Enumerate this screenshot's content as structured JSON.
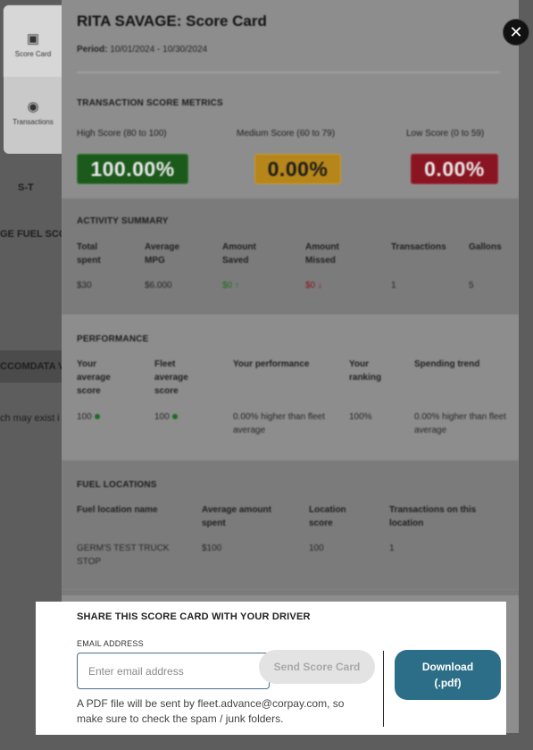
{
  "background": {
    "fragments": [
      "S-T",
      "GE FUEL SCO",
      "CCOMDATA V",
      "ch may exist i"
    ]
  },
  "side_tabs": [
    {
      "label": "Score Card",
      "icon": "scorecard-icon"
    },
    {
      "label": "Transactions",
      "icon": "transactions-icon"
    }
  ],
  "header": {
    "title": "RITA SAVAGE: Score Card",
    "period_label": "Period:",
    "period_value": "10/01/2024 - 10/30/2024"
  },
  "metrics": {
    "heading": "TRANSACTION SCORE METRICS",
    "high": {
      "label": "High Score (80 to 100)",
      "value": "100.00%",
      "color": "#1c5a1c"
    },
    "medium": {
      "label": "Medium Score (60 to 79)",
      "value": "0.00%",
      "color": "#b6861a"
    },
    "low": {
      "label": "Low Score (0 to 59)",
      "value": "0.00%",
      "color": "#8a1522"
    }
  },
  "activity": {
    "heading": "ACTIVITY SUMMARY",
    "columns": [
      "Total spent",
      "Average MPG",
      "Amount Saved",
      "Amount Missed",
      "Transactions",
      "Gallons"
    ],
    "values": [
      "$30",
      "$6.000",
      "$0",
      "$0",
      "1",
      "5"
    ],
    "saved_arrow": "↑",
    "missed_arrow": "↓"
  },
  "performance": {
    "heading": "PERFORMANCE",
    "columns": [
      "Your average score",
      "Fleet average score",
      "Your performance",
      "Your ranking",
      "Spending trend"
    ],
    "values": [
      "100",
      "100",
      "0.00% higher than fleet average",
      "100%",
      "0.00% higher than fleet average"
    ]
  },
  "locations": {
    "heading": "FUEL LOCATIONS",
    "columns": [
      "Fuel location name",
      "Average amount spent",
      "Location score",
      "Transactions on this location"
    ],
    "values": [
      "GERM'S TEST TRUCK STOP",
      "$100",
      "100",
      "1"
    ]
  },
  "share": {
    "title": "SHARE THIS SCORE CARD WITH YOUR DRIVER",
    "email_label": "EMAIL ADDRESS",
    "email_placeholder": "Enter email address",
    "send_label": "Send Score Card",
    "download_label_1": "Download",
    "download_label_2": "(.pdf)",
    "note": "A PDF file will be sent by fleet.advance@corpay.com, so make sure to check the spam / junk folders."
  },
  "close_symbol": "✕"
}
